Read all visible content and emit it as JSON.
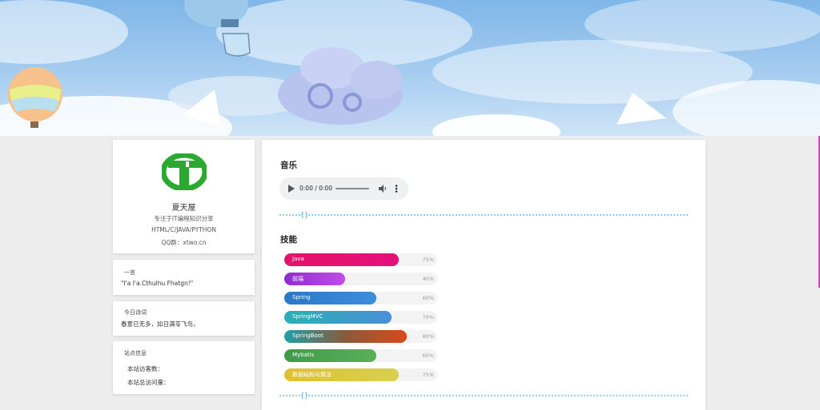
{
  "profile": {
    "name": "夏天屋",
    "tagline": "专注于IT编程知识分享",
    "tech": "HTML/C/JAVA/PYTHON",
    "qq": "QQ群：xtwo.cn",
    "logo_color": "#2aa82f"
  },
  "quote_card": {
    "heading": "一言",
    "text": "\"I'a I'a.Cthulhu Fhatgn!\""
  },
  "poem_card": {
    "heading": "今日诗词",
    "text": "春意已无多，如日满苓飞鸟，"
  },
  "stats_card": {
    "heading": "站点信息",
    "visitors_label": "本站访客数：",
    "views_label": "本站总访问量："
  },
  "music": {
    "title": "音乐",
    "time": "0:00 / 0:00",
    "play_icon": "play-icon",
    "volume_icon": "volume-icon",
    "menu_icon": "more-vertical-icon"
  },
  "divider_mark": "{}",
  "skills": {
    "title": "技能",
    "items": [
      {
        "name": "Java",
        "level": 75,
        "label": "75%",
        "gradient": "linear-gradient(90deg,#e2146a,#e4117c)"
      },
      {
        "name": "前端",
        "level": 40,
        "label": "40%",
        "gradient": "linear-gradient(90deg,#8e2cd4,#c24ce8)"
      },
      {
        "name": "Spring",
        "level": 60,
        "label": "60%",
        "gradient": "linear-gradient(90deg,#2a78c8,#3b8edc)"
      },
      {
        "name": "SpringMVC",
        "level": 70,
        "label": "70%",
        "gradient": "linear-gradient(90deg,#2ab0b4,#4a8fd6)"
      },
      {
        "name": "SpringBoot",
        "level": 80,
        "label": "80%",
        "gradient": "linear-gradient(90deg,#1fa0a8,#8a5a3a,#d84a1a)"
      },
      {
        "name": "Mybatis",
        "level": 60,
        "label": "60%",
        "gradient": "linear-gradient(90deg,#3e9a4a,#5ab05a)"
      },
      {
        "name": "数据结构与算法",
        "level": 75,
        "label": "75%",
        "gradient": "linear-gradient(90deg,#e0c030,#d8d050)"
      }
    ]
  }
}
